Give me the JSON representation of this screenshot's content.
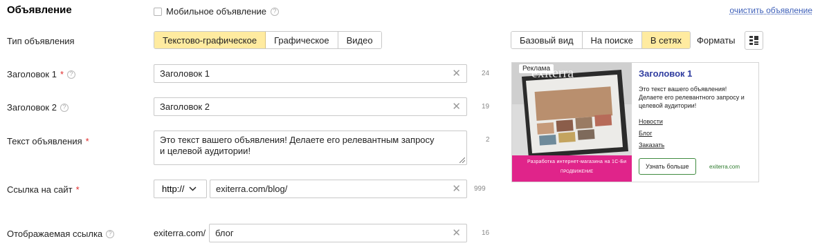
{
  "header": {
    "title": "Объявление",
    "mobile_label": "Мобильное объявление",
    "clear_link": "очистить объявление"
  },
  "ad_type": {
    "label": "Тип объявления",
    "options": [
      "Текстово-графическое",
      "Графическое",
      "Видео"
    ],
    "selected": "Текстово-графическое"
  },
  "fields": {
    "title1": {
      "label": "Заголовок 1",
      "value": "Заголовок 1",
      "count": "24"
    },
    "title2": {
      "label": "Заголовок 2",
      "value": "Заголовок 2",
      "count": "19"
    },
    "text": {
      "label": "Текст объявления",
      "value": "Это текст вашего объявления! Делаете его релевантным запросу\nи целевой аудитории!",
      "count": "2"
    },
    "link": {
      "label": "Ссылка на сайт",
      "protocol": "http://",
      "value": "exiterra.com/blog/",
      "count": "999"
    },
    "display_link": {
      "label": "Отображаемая ссылка",
      "prefix": "exiterra.com/",
      "value": "блог",
      "count": "16"
    }
  },
  "preview_tabs": {
    "options": [
      "Базовый вид",
      "На поиске",
      "В сетях"
    ],
    "selected": "В сетях",
    "formats_label": "Форматы"
  },
  "preview": {
    "badge": "Реклама",
    "title": "Заголовок 1",
    "text": "Это текст вашего объявления! Делаете его релевантного запросу и целевой аудитории!",
    "links": [
      "Новости",
      "Блог",
      "Заказать"
    ],
    "button": "Узнать больше",
    "domain": "exiterra.com",
    "image_caption": "Разработка интернет-магазина на 1С-Би",
    "image_sub": "продвижение",
    "image_watermark": "exiterra"
  },
  "colors": {
    "active_bg": "#ffeba0",
    "required": "#e02a2a",
    "link": "#3d5fb8",
    "ad_title": "#2f3c9f",
    "ad_domain": "#2c7a2c",
    "image_band": "#e0248a"
  },
  "icons": [
    "help-icon",
    "clear-icon",
    "chevron-down-icon",
    "grid-layout-icon",
    "resize-grip-icon"
  ]
}
